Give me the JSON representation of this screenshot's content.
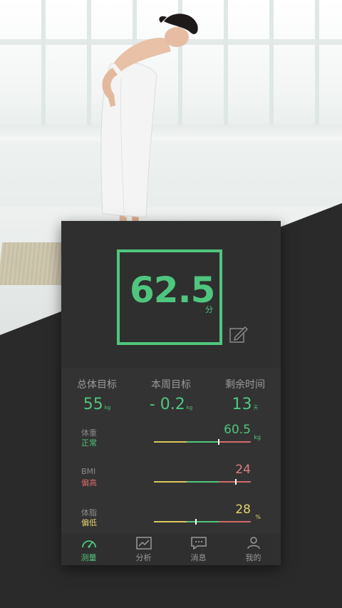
{
  "score": {
    "value": "62.5",
    "unit": "分"
  },
  "summary": [
    {
      "title": "总体目标",
      "value": "55",
      "unit": "kg"
    },
    {
      "title": "本周目标",
      "value": "- 0.2",
      "unit": "kg"
    },
    {
      "title": "剩余时间",
      "value": "13",
      "unit": "天"
    }
  ],
  "metrics": [
    {
      "label": "体重",
      "status": "正常",
      "value": "60.5",
      "unit": "kg",
      "status_color": "#4fc67e",
      "value_color": "#4fc67e",
      "marker_fraction": 0.66
    },
    {
      "label": "BMI",
      "status": "偏高",
      "value": "24",
      "unit": "",
      "status_color": "#d46a6a",
      "value_color": "#d98080",
      "marker_fraction": 0.84
    },
    {
      "label": "体脂",
      "status": "偏低",
      "value": "28",
      "unit": "%",
      "status_color": "#e3d36b",
      "value_color": "#e3d36b",
      "marker_fraction": 0.43
    }
  ],
  "tabs": [
    {
      "label": "测量",
      "icon": "gauge-icon",
      "active": true
    },
    {
      "label": "分析",
      "icon": "chart-icon",
      "active": false
    },
    {
      "label": "消息",
      "icon": "message-icon",
      "active": false
    },
    {
      "label": "我的",
      "icon": "person-icon",
      "active": false
    }
  ],
  "colors": {
    "accent": "#4fc67e",
    "warn": "#d46a6a",
    "low": "#e3d36b",
    "bar_yellow": "#d9c85a",
    "bar_green": "#4fc67e",
    "bar_red": "#d46a6a"
  }
}
